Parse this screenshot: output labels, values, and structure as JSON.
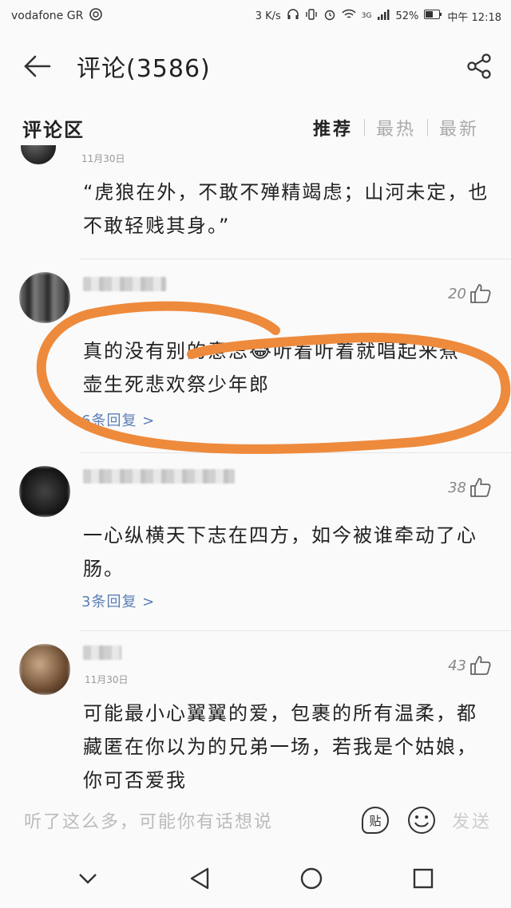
{
  "status": {
    "carrier": "vodafone GR",
    "speed": "3 K/s",
    "network": "3G",
    "battery": "52%",
    "time": "中午 12:18"
  },
  "header": {
    "title": "评论(3586)"
  },
  "section": {
    "title": "评论区",
    "tabs": [
      "推荐",
      "最热",
      "最新"
    ]
  },
  "comments": [
    {
      "date": "11月30日",
      "text": "“虎狼在外，不敢不殚精竭虑；山河未定，也不敢轻贱其身。”"
    },
    {
      "likes": "20",
      "text": "真的没有别的意思😂听着听着就唱起来煮一壶生死悲欢祭少年郎",
      "replies": "6条回复 >"
    },
    {
      "likes": "38",
      "text": "一心纵横天下志在四方，如今被谁牵动了心肠。",
      "replies": "3条回复 >"
    },
    {
      "likes": "43",
      "date": "11月30日",
      "text": "可能最小心翼翼的爱，包裹的所有温柔，都藏匿在你以为的兄弟一场，若我是个姑娘，你可否爱我"
    }
  ],
  "input": {
    "placeholder": "听了这么多，可能你有话想说",
    "sticker_label": "贴",
    "send_label": "发送"
  },
  "colors": {
    "annotation": "#ee8a3c",
    "reply_link": "#5a7eb6"
  }
}
